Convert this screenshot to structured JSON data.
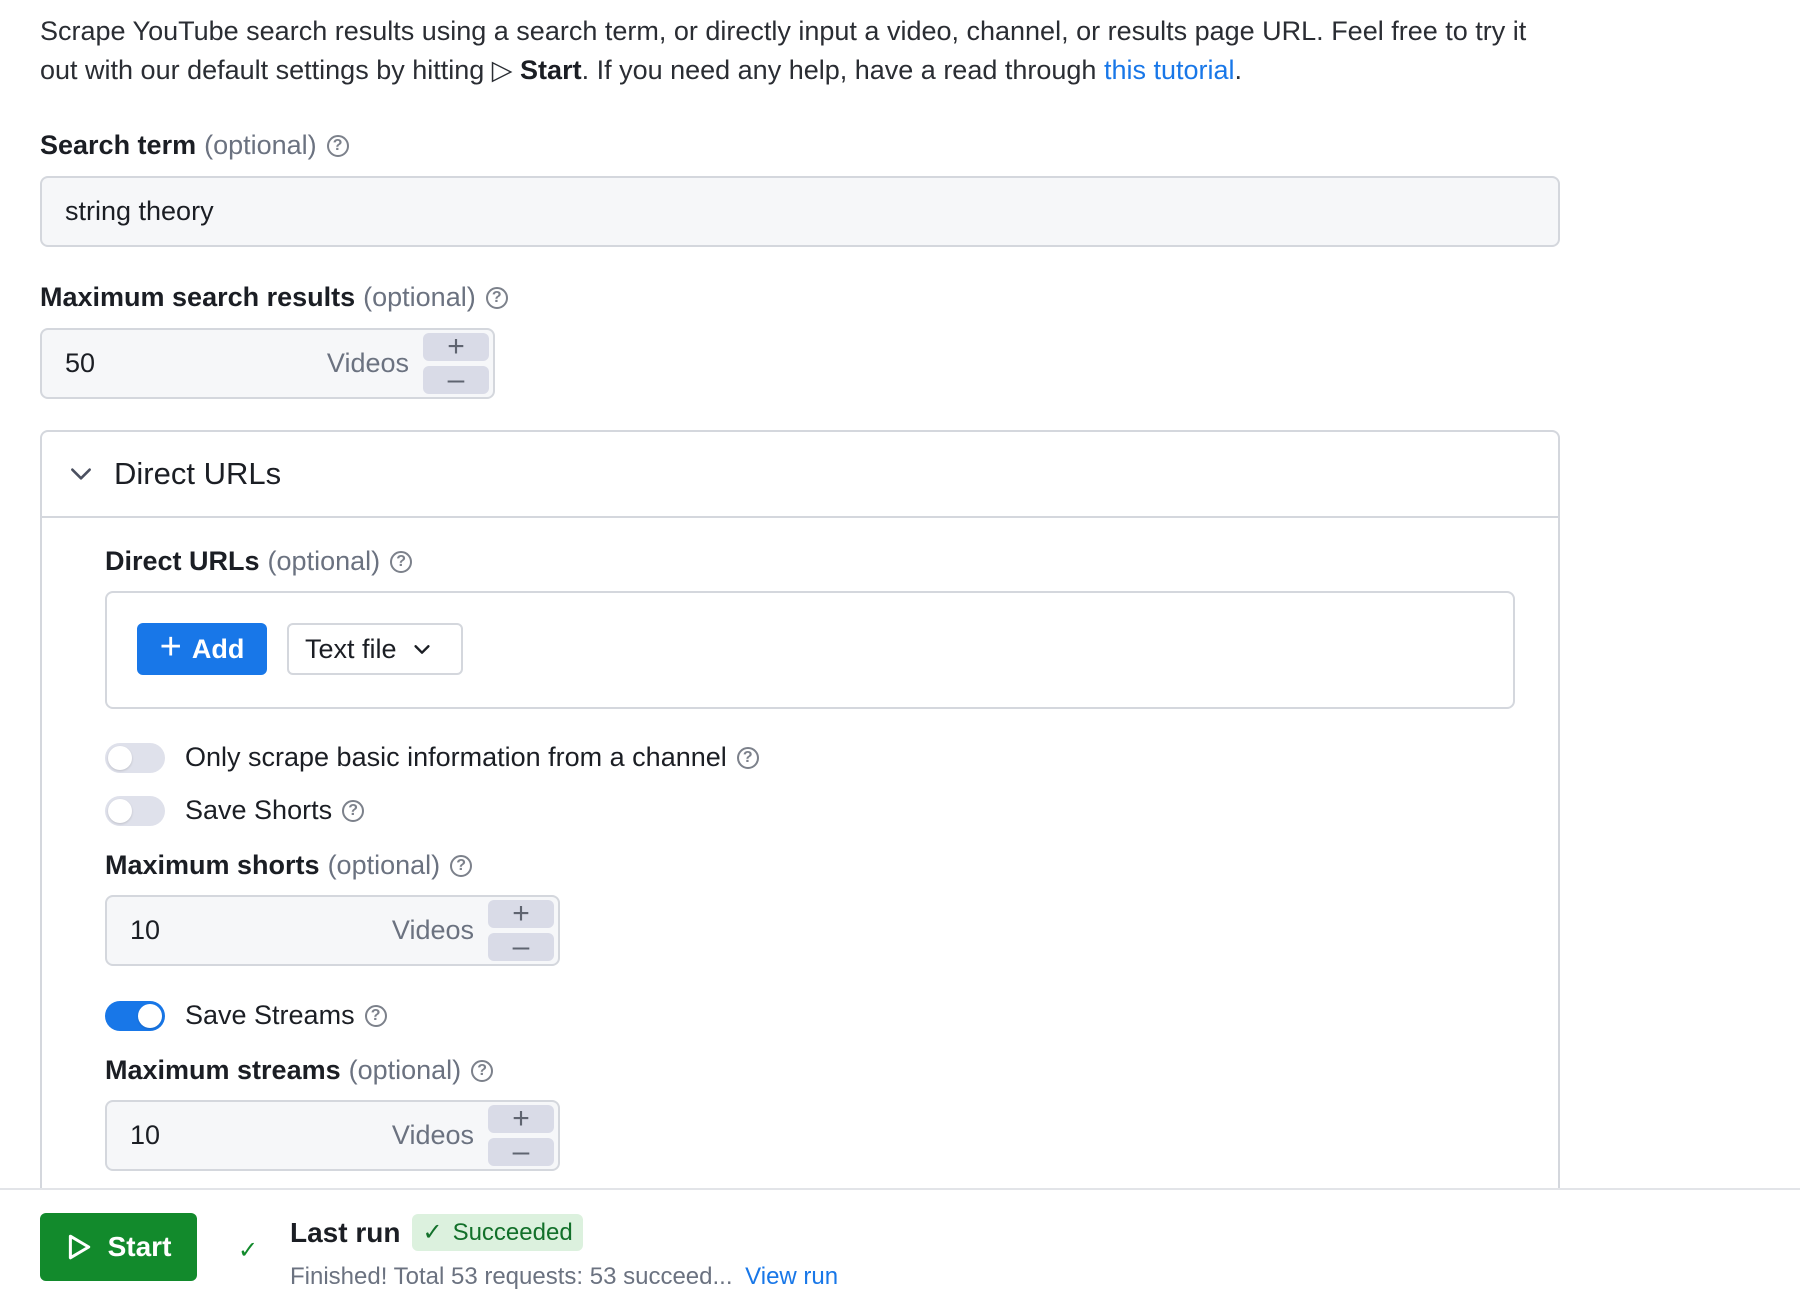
{
  "intro": {
    "text_before": "Scrape YouTube search results using a search term, or directly input a video, channel, or results page URL. Feel free to try it out with our default settings by hitting ",
    "start_glyph": "▷",
    "start_word": "Start",
    "text_middle": ". If you need any help, have a read through ",
    "tutorial_link": "this tutorial",
    "text_after": "."
  },
  "search_term": {
    "label": "Search term",
    "optional": "(optional)",
    "value": "string theory",
    "help_icon": "help-circle-icon"
  },
  "max_search_results": {
    "label": "Maximum search results",
    "optional": "(optional)",
    "value": "50",
    "unit": "Videos",
    "increment": "+",
    "decrement": "–"
  },
  "direct_urls_section": {
    "title": "Direct URLs",
    "field_label": "Direct URLs",
    "optional": "(optional)",
    "add_button": "Add",
    "source_select": "Text file"
  },
  "toggles": {
    "basic_channel_info": {
      "label": "Only scrape basic information from a channel",
      "on": false
    },
    "save_shorts": {
      "label": "Save Shorts",
      "on": false
    },
    "save_streams": {
      "label": "Save Streams",
      "on": true
    }
  },
  "max_shorts": {
    "label": "Maximum shorts",
    "optional": "(optional)",
    "value": "10",
    "unit": "Videos",
    "increment": "+",
    "decrement": "–"
  },
  "max_streams": {
    "label": "Maximum streams",
    "optional": "(optional)",
    "value": "10",
    "unit": "Videos",
    "increment": "+",
    "decrement": "–"
  },
  "footer": {
    "start_button": "Start",
    "last_run_label": "Last run",
    "status_badge": "Succeeded",
    "run_description": "Finished! Total 53 requests: 53 succeed...",
    "view_run_link": "View run"
  },
  "colors": {
    "accent_blue": "#1877e8",
    "start_green": "#128a2c",
    "success_badge_bg": "#dcf1de"
  }
}
